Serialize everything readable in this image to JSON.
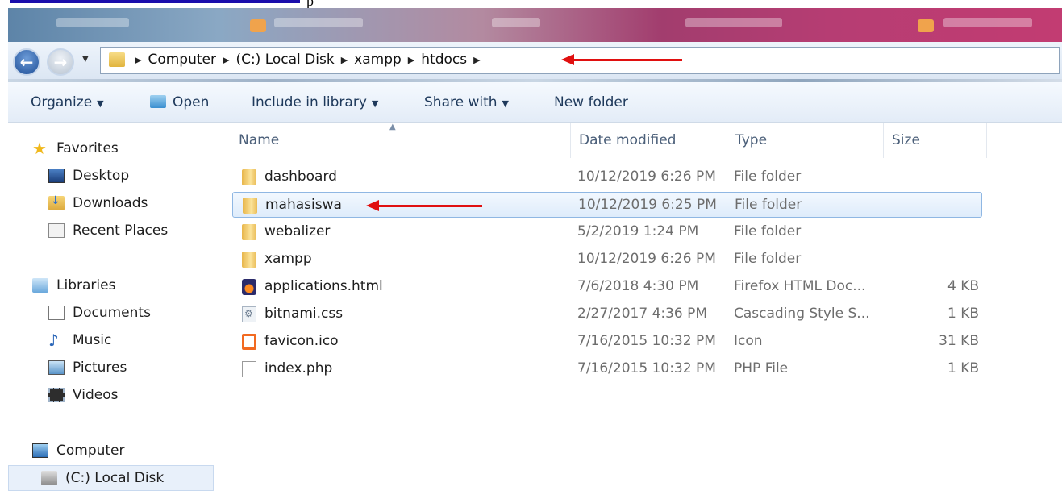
{
  "doc_remnant": {
    "char": "p"
  },
  "address": {
    "crumbs": [
      "Computer",
      "(C:) Local Disk",
      "xampp",
      "htdocs"
    ]
  },
  "toolbar": {
    "organize": "Organize",
    "open": "Open",
    "include_in_library": "Include in library",
    "share_with": "Share with",
    "new_folder": "New folder"
  },
  "navpane": {
    "favorites": "Favorites",
    "desktop": "Desktop",
    "downloads": "Downloads",
    "recent_places": "Recent Places",
    "libraries": "Libraries",
    "documents": "Documents",
    "music": "Music",
    "pictures": "Pictures",
    "videos": "Videos",
    "computer": "Computer",
    "local_disk": "(C:) Local Disk"
  },
  "columns": {
    "name": "Name",
    "date_modified": "Date modified",
    "type": "Type",
    "size": "Size"
  },
  "files": [
    {
      "name": "dashboard",
      "date": "10/12/2019 6:26 PM",
      "type": "File folder",
      "size": "",
      "icon": "folder-icon"
    },
    {
      "name": "mahasiswa",
      "date": "10/12/2019 6:25 PM",
      "type": "File folder",
      "size": "",
      "icon": "folder-icon"
    },
    {
      "name": "webalizer",
      "date": "5/2/2019 1:24 PM",
      "type": "File folder",
      "size": "",
      "icon": "folder-icon"
    },
    {
      "name": "xampp",
      "date": "10/12/2019 6:26 PM",
      "type": "File folder",
      "size": "",
      "icon": "folder-icon"
    },
    {
      "name": "applications.html",
      "date": "7/6/2018 4:30 PM",
      "type": "Firefox HTML Doc...",
      "size": "4 KB",
      "icon": "firefox-html-icon"
    },
    {
      "name": "bitnami.css",
      "date": "2/27/2017 4:36 PM",
      "type": "Cascading Style S...",
      "size": "1 KB",
      "icon": "css-file-icon"
    },
    {
      "name": "favicon.ico",
      "date": "7/16/2015 10:32 PM",
      "type": "Icon",
      "size": "31 KB",
      "icon": "ico-file-icon"
    },
    {
      "name": "index.php",
      "date": "7/16/2015 10:32 PM",
      "type": "PHP File",
      "size": "1 KB",
      "icon": "blank-file-icon"
    }
  ],
  "colors": {
    "annotation_arrow": "#e01010",
    "selection": "#deecfb"
  }
}
